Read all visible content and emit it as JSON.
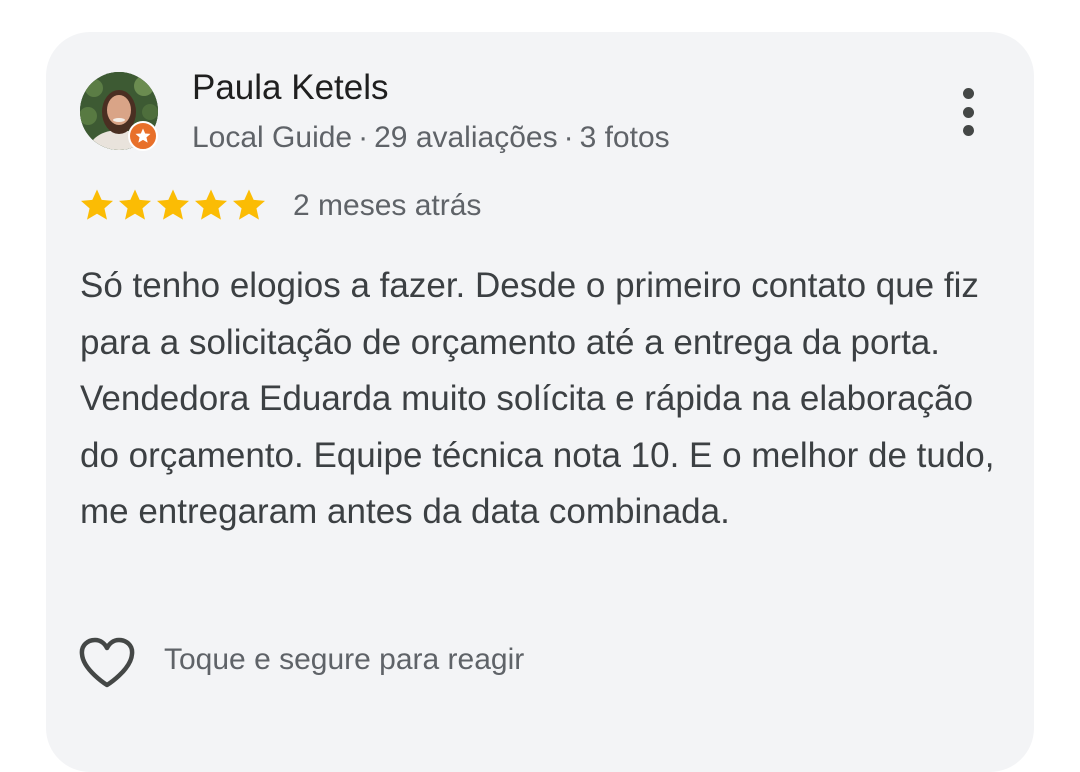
{
  "reviewer": {
    "name": "Paula Ketels",
    "level": "Local Guide",
    "separator": "·",
    "reviews": "29 avaliações",
    "photos": "3 fotos"
  },
  "rating": {
    "stars": 5,
    "max": 5,
    "star_color": "#fbbc04",
    "time_ago": "2 meses atrás"
  },
  "review": {
    "text": "Só tenho elogios a fazer. Desde o primeiro contato que fiz para a solicitação de orçamento até a entrega da porta. Vendedora Eduarda muito solícita e rápida na elaboração do orçamento. Equipe técnica nota 10. E o melhor de tudo, me entregaram antes da data combinada."
  },
  "actions": {
    "react_label": "Toque e segure para reagir",
    "react_icon": "heart-outline-icon",
    "menu_icon": "more-vert-icon"
  },
  "colors": {
    "card_bg": "#f3f4f6",
    "badge": "#e8702a"
  }
}
